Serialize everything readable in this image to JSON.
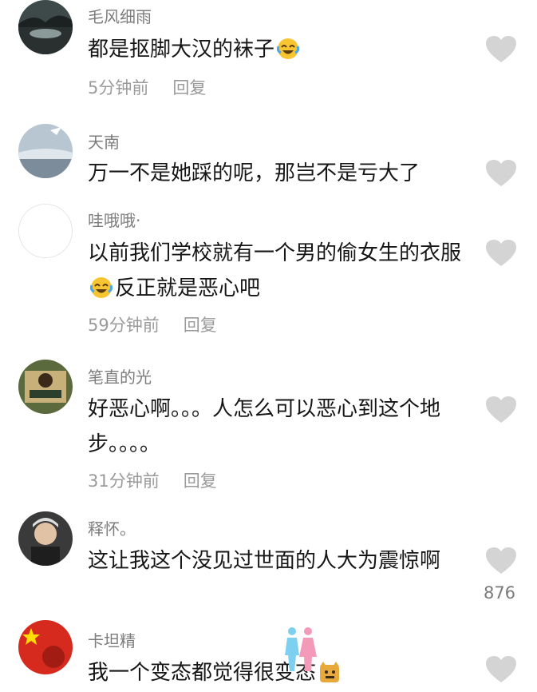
{
  "colors": {
    "username": "#7c7c7c",
    "text": "#161616",
    "meta": "#9a9a9a",
    "like": "#d4d4d4"
  },
  "comments": [
    {
      "username": "毛风细雨",
      "text": "都是抠脚大汉的袜子",
      "text_after": "",
      "emoji": "laugh-cry-emoji",
      "time": "5分钟前",
      "reply": "回复",
      "likes": ""
    },
    {
      "username": "天南",
      "text": "万一不是她踩的呢，那岂不是亏大了",
      "text_after": "",
      "emoji": "",
      "time": "",
      "reply": "",
      "likes": ""
    },
    {
      "username": "哇哦哦·",
      "text": "以前我们学校就有一个男的偷女生的衣服",
      "text_after": "反正就是恶心吧",
      "emoji": "laugh-cry-emoji",
      "time": "59分钟前",
      "reply": "回复",
      "likes": ""
    },
    {
      "username": "笔直的光",
      "text": "好恶心啊。。。人怎么可以恶心到这个地步。。。。",
      "text_after": "",
      "emoji": "",
      "time": "31分钟前",
      "reply": "回复",
      "likes": ""
    },
    {
      "username": "释怀。",
      "text": "这让我这个没见过世面的人大为震惊啊",
      "text_after": "",
      "emoji": "",
      "time": "",
      "reply": "",
      "likes": "876"
    },
    {
      "username": "卡坦精",
      "text": "我一个变态都觉得很变态",
      "text_after": "",
      "emoji": "doge-emoji",
      "time": "",
      "reply": "",
      "likes": ""
    }
  ],
  "icons": {
    "like": "heart-icon"
  }
}
